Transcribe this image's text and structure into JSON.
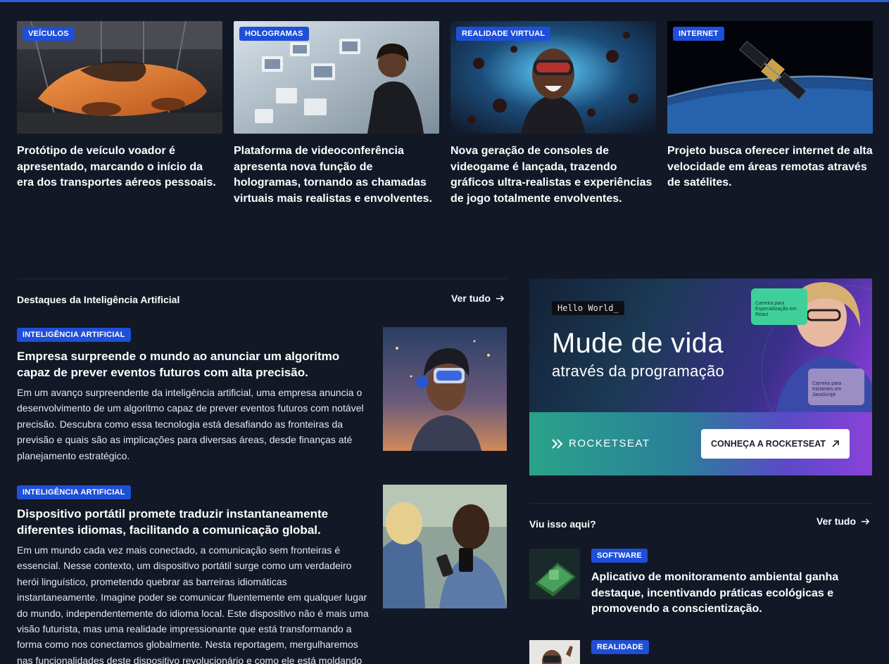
{
  "cards": [
    {
      "category": "Veículos",
      "title": "Protótipo de veículo voador é apresentado, marcando o início da era dos transportes aéreos pessoais."
    },
    {
      "category": "Hologramas",
      "title": "Plataforma de videoconferência apresenta nova função de hologramas, tornando as chamadas virtuais mais realistas e envolventes."
    },
    {
      "category": "Realidade Virtual",
      "title": "Nova geração de consoles de videogame é lançada, trazendo gráficos ultra-realistas e experiências de jogo totalmente envolventes."
    },
    {
      "category": "Internet",
      "title": "Projeto busca oferecer internet de alta velocidade em áreas remotas através de satélites."
    }
  ],
  "ai_section": {
    "title": "Destaques da Inteligência Artificial",
    "see_all": "Ver tudo",
    "articles": [
      {
        "category": "Inteligência Artificial",
        "title": "Empresa surpreende o mundo ao anunciar um algoritmo capaz de prever eventos futuros com alta precisão.",
        "body": "Em um avanço surpreendente da inteligência artificial, uma empresa anuncia o desenvolvimento de um algoritmo capaz de prever eventos futuros com notável precisão. Descubra como essa tecnologia está desafiando as fronteiras da previsão e quais são as implicações para diversas áreas, desde finanças até planejamento estratégico."
      },
      {
        "category": "Inteligência Artificial",
        "title": "Dispositivo portátil promete traduzir instantaneamente diferentes idiomas, facilitando a comunicação global.",
        "body": "Em um mundo cada vez mais conectado, a comunicação sem fronteiras é essencial. Nesse contexto, um dispositivo portátil surge como um verdadeiro herói linguístico, prometendo quebrar as barreiras idiomáticas instantaneamente. Imagine poder se comunicar fluentemente em qualquer lugar do mundo, independentemente do idioma local. Este dispositivo não é mais uma visão futurista, mas uma realidade impressionante que está transformando a forma como nos conectamos globalmente. Nesta reportagem, mergulharemos nas funcionalidades deste dispositivo revolucionário e como ele está moldando uma"
      }
    ]
  },
  "ad": {
    "hello": "Hello World_",
    "headline": "Mude de vida",
    "subheadline": "através da programação",
    "brand": "ROCKETSEAT",
    "cta": "CONHEÇA A ROCKETSEAT",
    "mini_card_1": "Carreira para Especialização em React",
    "mini_card_2": "Carreira para Iniciantes em JavaScript"
  },
  "seen_section": {
    "title": "Viu isso aqui?",
    "see_all": "Ver tudo",
    "items": [
      {
        "category": "Software",
        "title": "Aplicativo de monitoramento ambiental ganha destaque, incentivando práticas ecológicas e promovendo a conscientização."
      },
      {
        "category": "Realidade",
        "title": ""
      }
    ]
  }
}
